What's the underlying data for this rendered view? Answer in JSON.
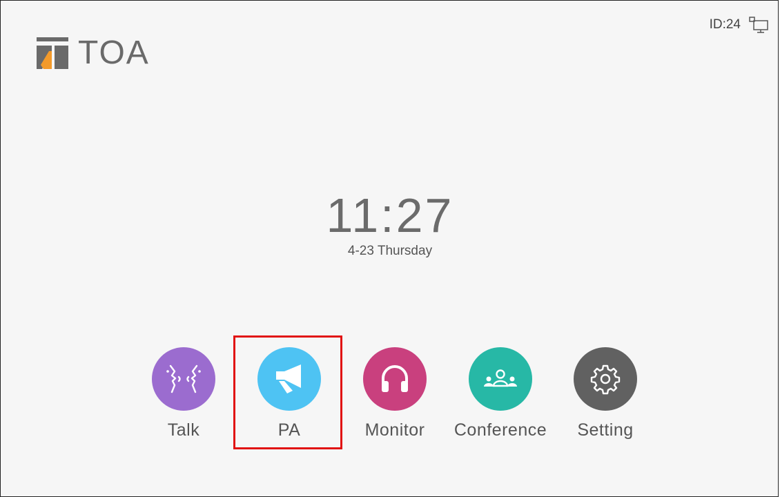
{
  "header": {
    "logo_text": "TOA",
    "device_id": "ID:24"
  },
  "clock": {
    "time": "11:27",
    "date": "4-23 Thursday"
  },
  "apps": [
    {
      "label": "Talk",
      "color": "#9b6ccf"
    },
    {
      "label": "PA",
      "color": "#4ec3f3"
    },
    {
      "label": "Monitor",
      "color": "#c9407e"
    },
    {
      "label": "Conference",
      "color": "#27b8a6"
    },
    {
      "label": "Setting",
      "color": "#616161"
    }
  ],
  "highlight_color": "#e11111"
}
